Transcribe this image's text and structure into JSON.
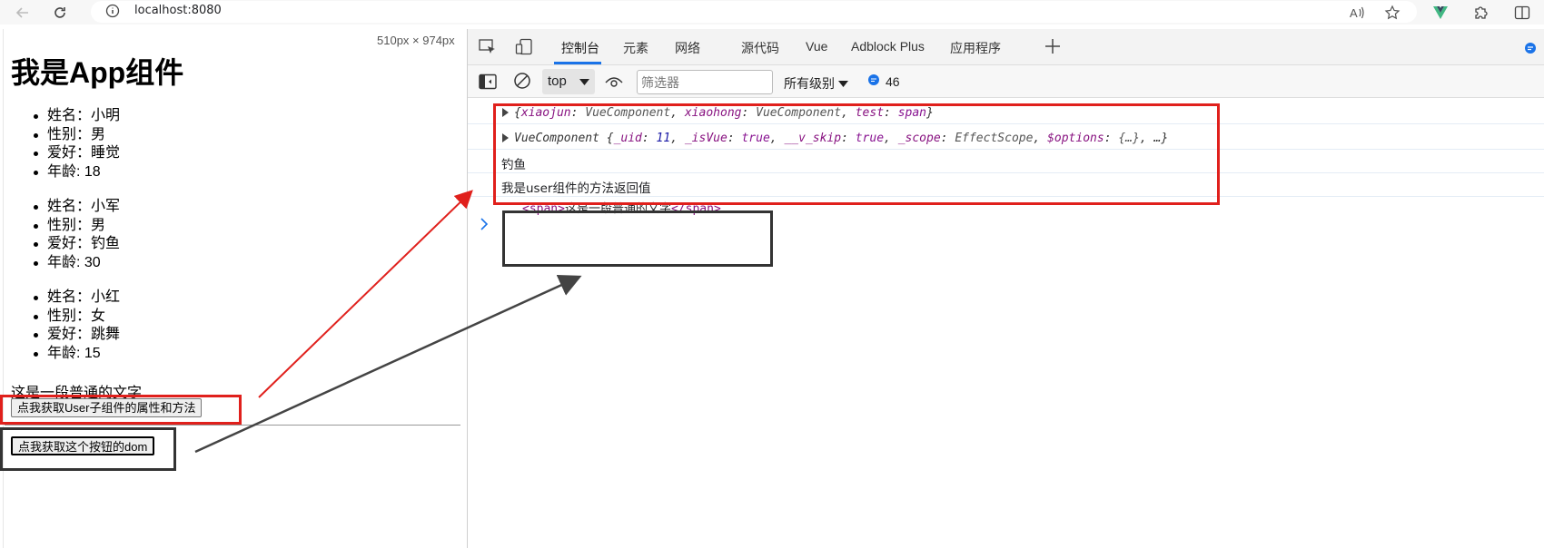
{
  "browser": {
    "url": "localhost:8080"
  },
  "page": {
    "dimensions_label": "510px × 974px",
    "title": "我是App组件",
    "persons": [
      [
        "姓名：小明",
        "性别：男",
        "爱好：睡觉",
        "年龄: 18"
      ],
      [
        "姓名：小军",
        "性别：男",
        "爱好：钓鱼",
        "年龄: 30"
      ],
      [
        "姓名：小红",
        "性别：女",
        "爱好：跳舞",
        "年龄: 15"
      ]
    ],
    "plain_text": "这是一段普通的文字",
    "get_user_button": "点我获取User子组件的属性和方法",
    "get_dom_button": "点我获取这个按钮的dom"
  },
  "devtools": {
    "tabs": [
      {
        "label": "控制台",
        "active": true
      },
      {
        "label": "元素"
      },
      {
        "label": "网络"
      },
      {
        "label": "源代码"
      },
      {
        "label": "Vue"
      },
      {
        "label": "Adblock Plus"
      },
      {
        "label": "应用程序"
      }
    ],
    "context": "top",
    "filter_placeholder": "筛选器",
    "levels": "所有级别",
    "message_count": "46",
    "logs": {
      "refs_object": {
        "open": "{",
        "k1": "xiaojun",
        "v1": "VueComponent",
        "k2": "xiaohong",
        "v2": "VueComponent",
        "k3": "test",
        "v3": "span",
        "close": "}"
      },
      "vue_component": {
        "prefix": "VueComponent {",
        "k1": "_uid",
        "v1": "11",
        "k2": "_isVue",
        "v2": "true",
        "k3": "__v_skip",
        "v3": "true",
        "k4": "_scope",
        "v4": "EffectScope",
        "k5": "$options",
        "v5": "{…}",
        "suffix": "…}"
      },
      "hobby": "钓鱼",
      "method_return": "我是user组件的方法返回值",
      "span_open": "<span>",
      "span_text": "这是一段普通的文字",
      "span_close": "</span>"
    }
  },
  "colors": {
    "annotation_red": "#e0201c",
    "annotation_dark": "#333333",
    "accent_blue": "#1a73e8"
  }
}
